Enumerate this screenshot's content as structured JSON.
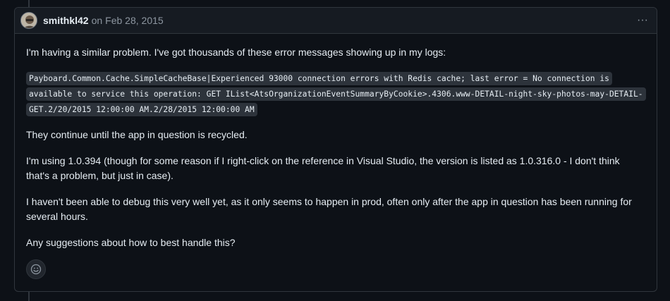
{
  "comment": {
    "author": "smithkl42",
    "on_text": "on",
    "date": "Feb 28, 2015",
    "menu_glyph": "···",
    "paragraphs": {
      "p1": "I'm having a similar problem. I've got thousands of these error messages showing up in my logs:",
      "code": "Payboard.Common.Cache.SimpleCacheBase|Experienced 93000 connection errors with Redis cache; last error = No connection is available to service this operation: GET IList<AtsOrganizationEventSummaryByCookie>.4306.www-DETAIL-night-sky-photos-may-DETAIL-GET.2/20/2015 12:00:00 AM.2/28/2015 12:00:00 AM",
      "p2": "They continue until the app in question is recycled.",
      "p3": "I'm using 1.0.394 (though for some reason if I right-click on the reference in Visual Studio, the version is listed as 1.0.316.0 - I don't think that's a problem, but just in case).",
      "p4": "I haven't been able to debug this very well yet, as it only seems to happen in prod, often only after the app in question has been running for several hours.",
      "p5": "Any suggestions about how to best handle this?"
    },
    "icons": {
      "avatar": "avatar-icon",
      "menu": "kebab-menu-icon",
      "reaction": "smiley-icon"
    }
  },
  "colors": {
    "background": "#0d1117",
    "header_bg": "#161b22",
    "border": "#30363d",
    "text": "#e6edf3",
    "muted": "#8d96a0",
    "code_bg": "#2d333b"
  }
}
